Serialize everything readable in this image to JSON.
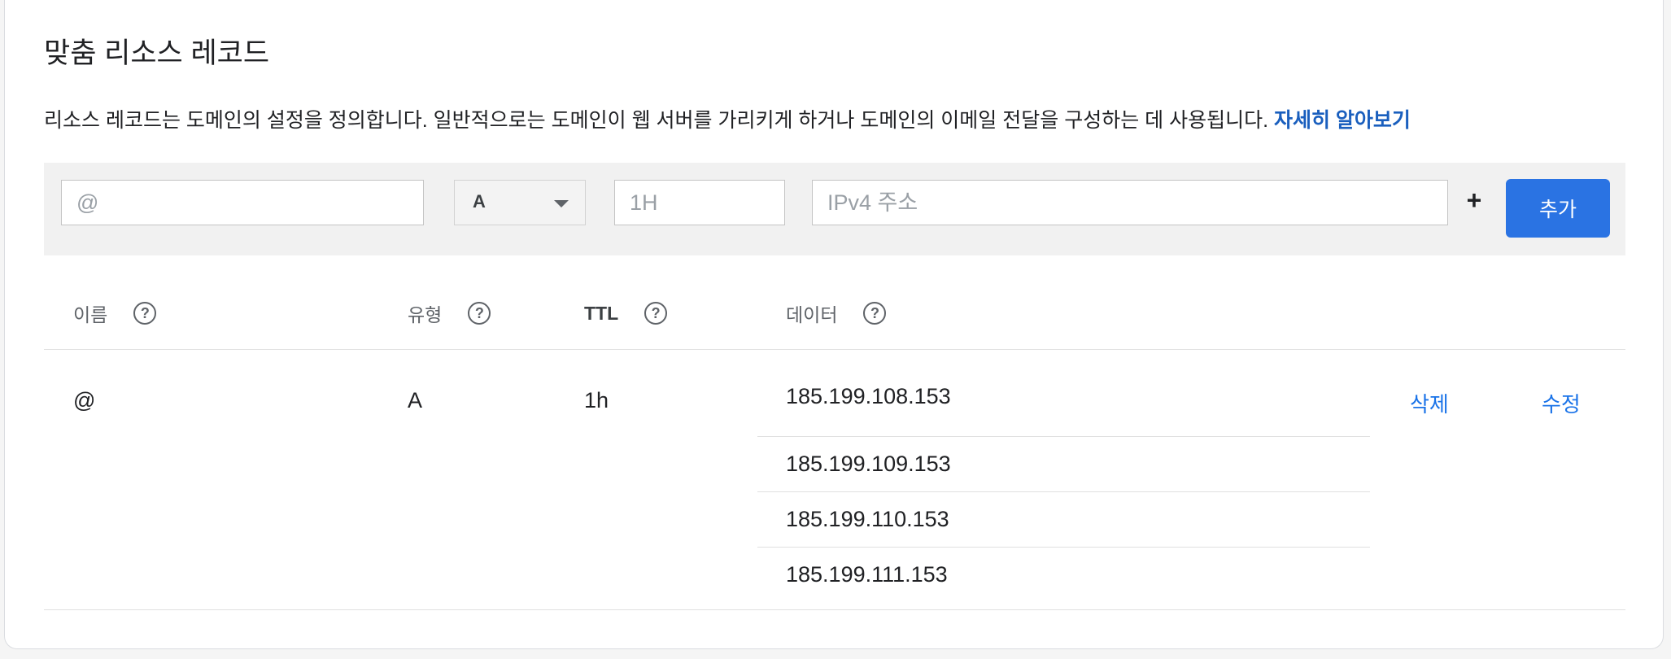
{
  "section": {
    "title": "맞춤 리소스 레코드",
    "description": "리소스 레코드는 도메인의 설정을 정의합니다. 일반적으로는 도메인이 웹 서버를 가리키게 하거나 도메인의 이메일 전달을 구성하는 데 사용됩니다.",
    "learn_more": "자세히 알아보기"
  },
  "add_form": {
    "name_placeholder": "@",
    "type_value": "A",
    "ttl_placeholder": "1H",
    "data_placeholder": "IPv4 주소",
    "plus_icon": "plus-icon",
    "add_label": "추가"
  },
  "table": {
    "headers": [
      {
        "label": "이름",
        "icon": "help-icon"
      },
      {
        "label": "유형",
        "icon": "help-icon"
      },
      {
        "label": "TTL",
        "icon": "help-icon"
      },
      {
        "label": "데이터",
        "icon": "help-icon"
      }
    ],
    "rows": [
      {
        "name": "@",
        "type": "A",
        "ttl": "1h",
        "data": [
          "185.199.108.153",
          "185.199.109.153",
          "185.199.110.153",
          "185.199.111.153"
        ],
        "delete_label": "삭제",
        "edit_label": "수정"
      }
    ]
  },
  "colors": {
    "accent": "#2a73e3",
    "link": "#1a73e8",
    "toolbar_bg": "#f1f1f1"
  }
}
